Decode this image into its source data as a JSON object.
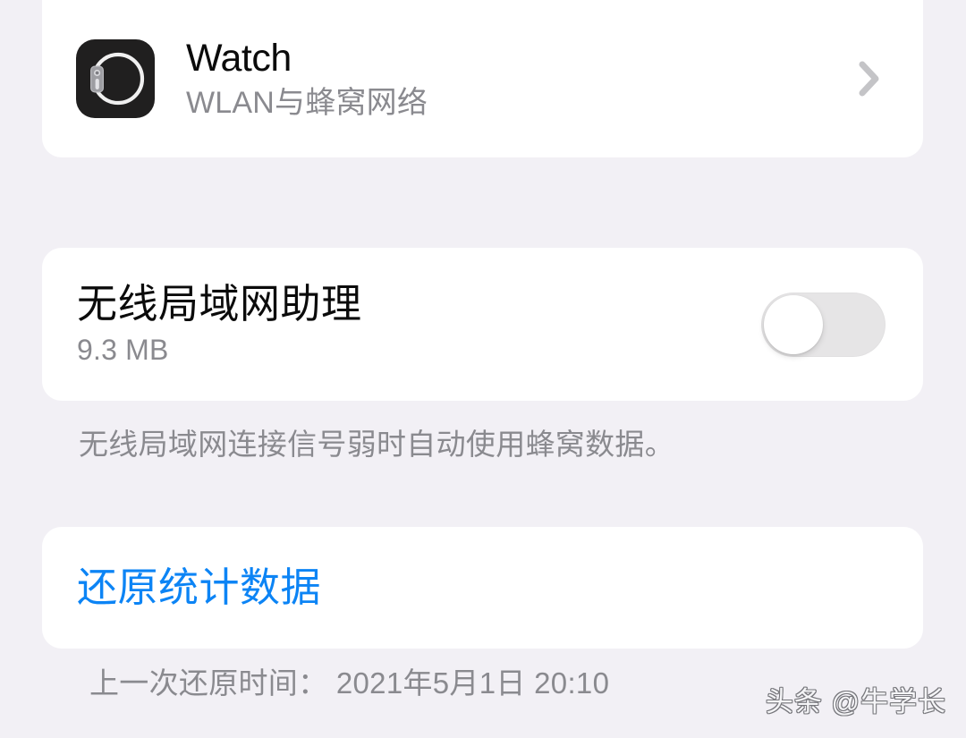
{
  "theme": {
    "background": "#f2f0f5",
    "card_background": "#ffffff",
    "primary_text": "#0b0b0b",
    "secondary_text": "#8a8a8f",
    "accent_blue": "#0c84f5",
    "toggle_off_track": "#e6e5e6",
    "toggle_knob": "#ffffff",
    "chevron_gray": "#c4c4c7",
    "app_icon_background": "#201f1f"
  },
  "watch_row": {
    "icon_name": "apple-watch-icon",
    "title": "Watch",
    "subtitle": "WLAN与蜂窝网络",
    "chevron_icon": "chevron-right-icon"
  },
  "wlan_assistant": {
    "title": "无线局域网助理",
    "data_usage": "9.3 MB",
    "toggle_state": "off",
    "description": "无线局域网连接信号弱时自动使用蜂窝数据。"
  },
  "reset_section": {
    "button_label": "还原统计数据",
    "last_reset_label": "上一次还原时间：",
    "last_reset_value": "2021年5月1日 20:10",
    "last_reset_full": "上一次还原时间： 2021年5月1日 20:10"
  },
  "watermark": {
    "text": "头条 @牛学长"
  }
}
